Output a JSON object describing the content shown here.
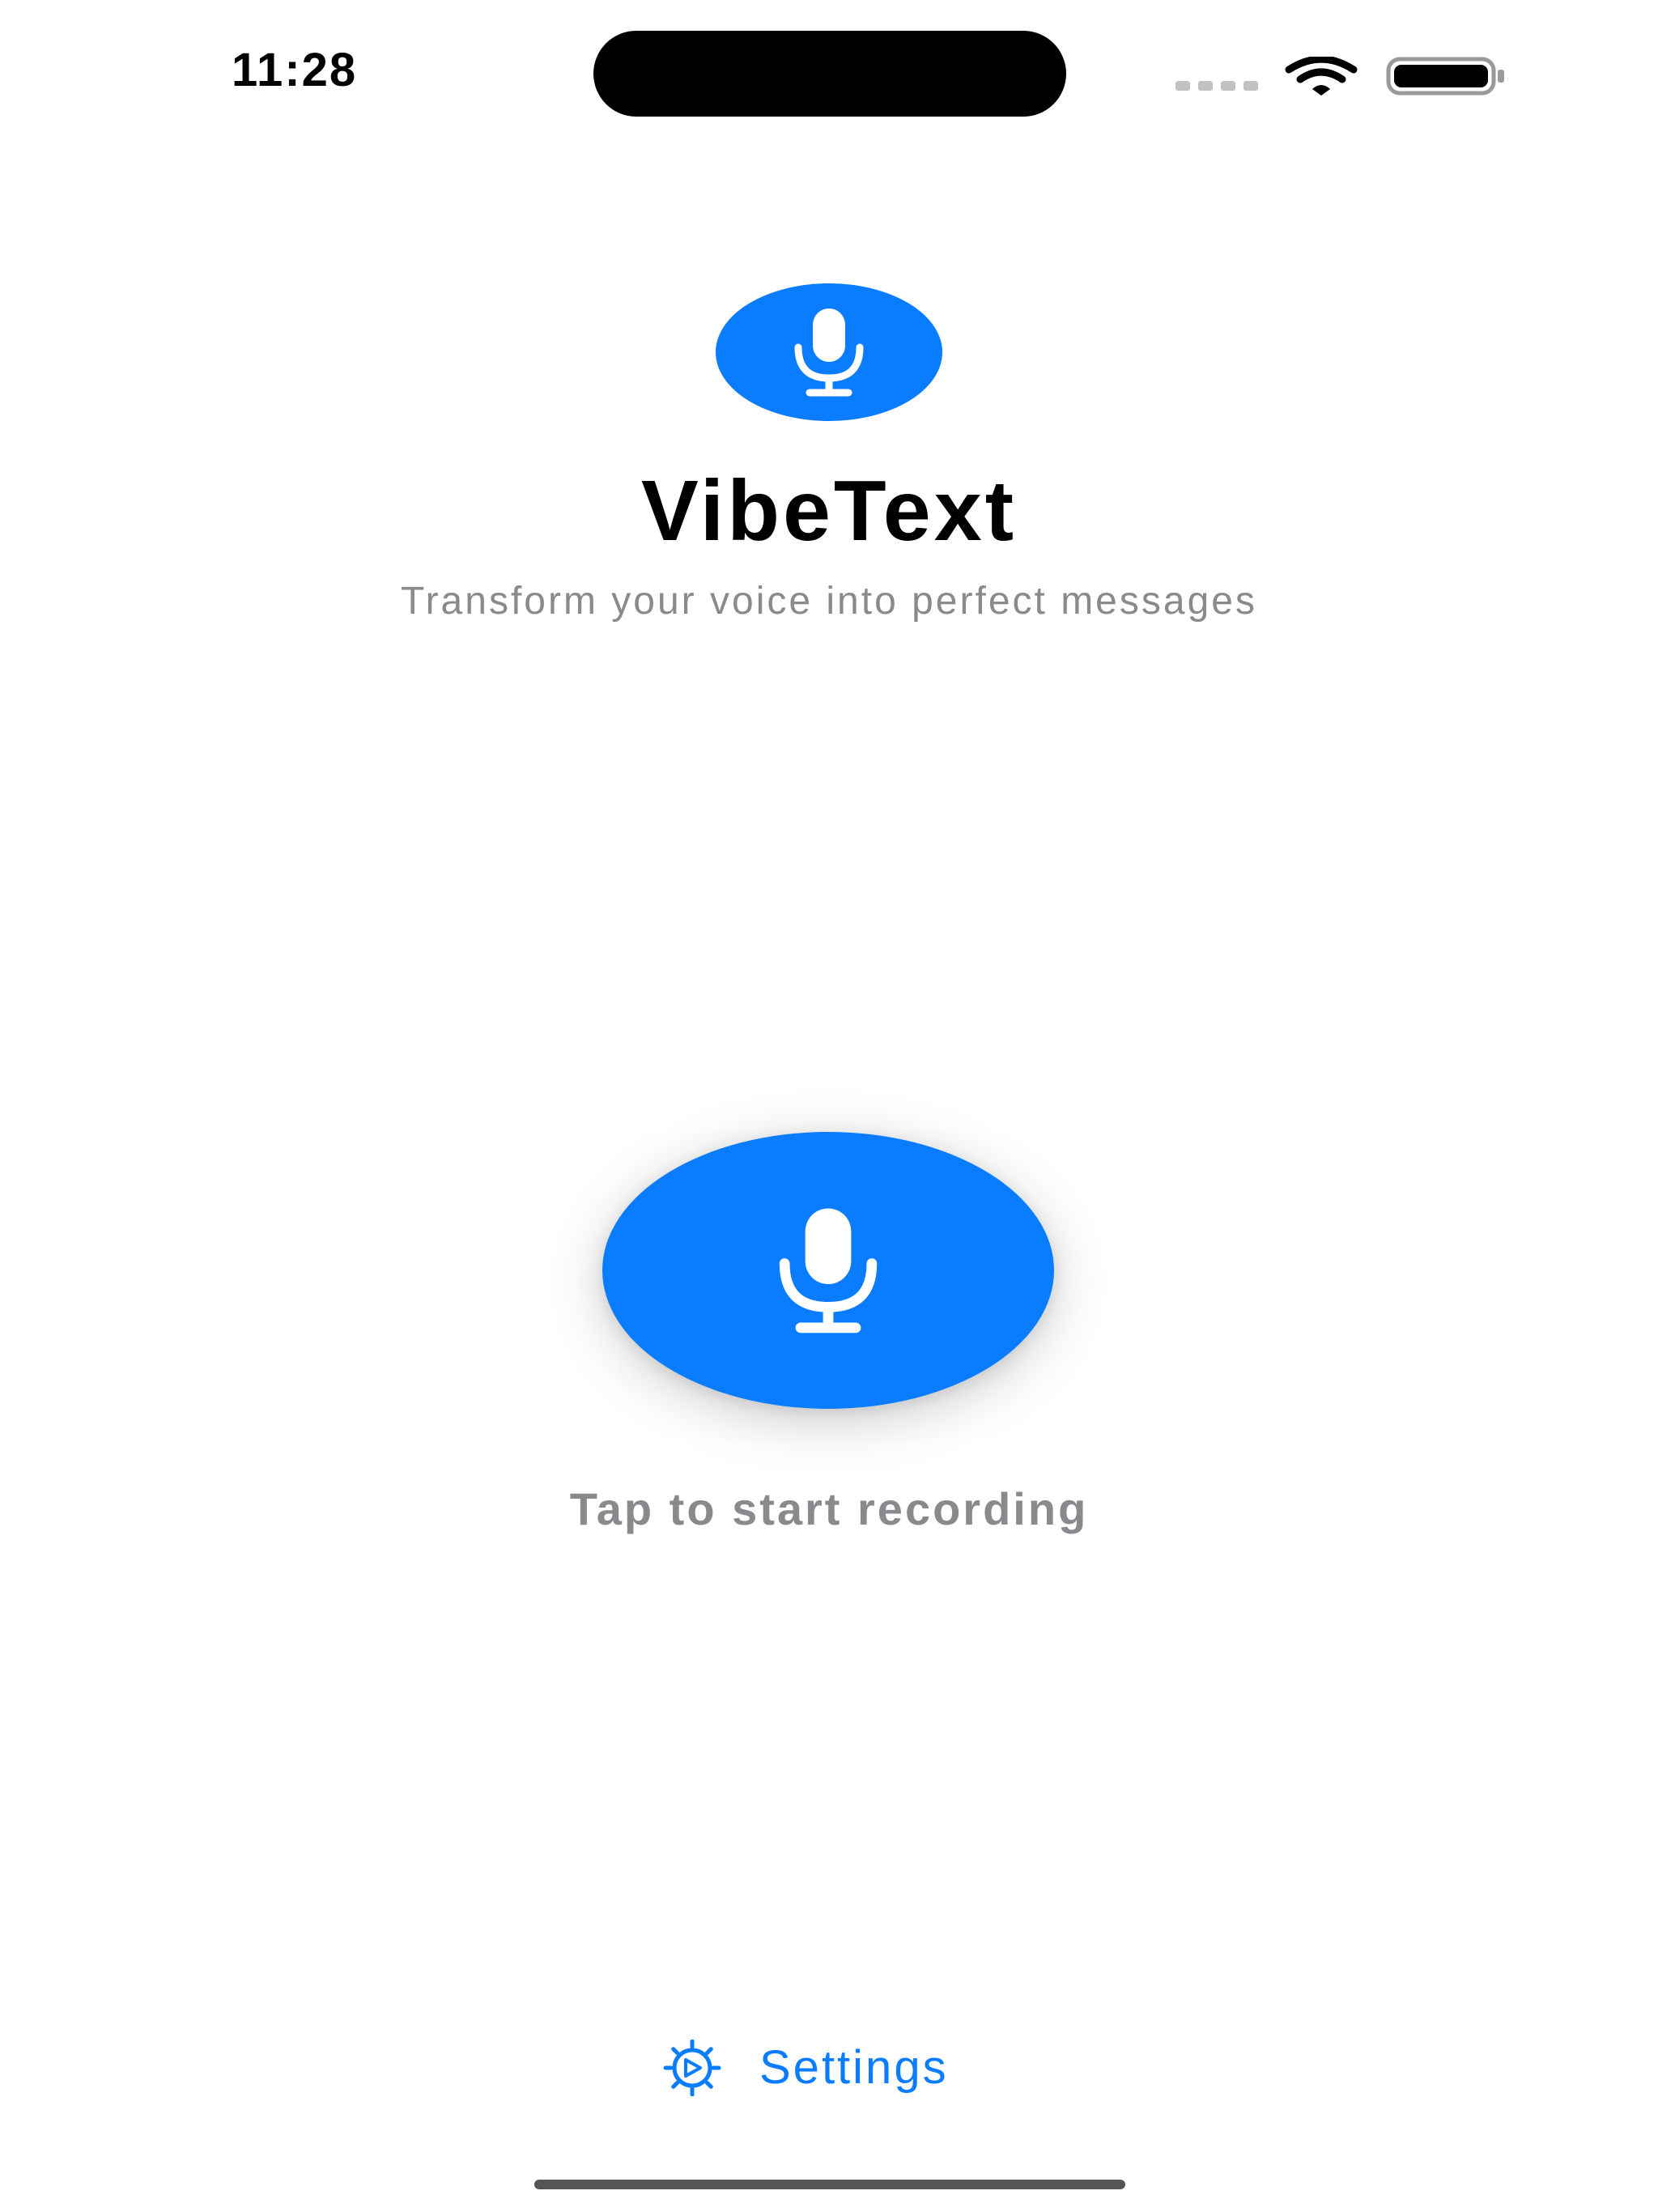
{
  "status_bar": {
    "time": "11:28",
    "wifi_icon": "wifi-icon",
    "battery_icon": "battery-full-icon"
  },
  "header": {
    "icon": "microphone-icon",
    "title": "VibeText",
    "subtitle": "Transform your voice into perfect messages"
  },
  "recorder": {
    "icon": "microphone-icon",
    "hint": "Tap to start recording"
  },
  "footer": {
    "settings_icon": "gear-icon",
    "settings_label": "Settings"
  },
  "colors": {
    "accent": "#0a7cff",
    "secondary_text": "#8a8a8e",
    "background": "#ffffff"
  }
}
